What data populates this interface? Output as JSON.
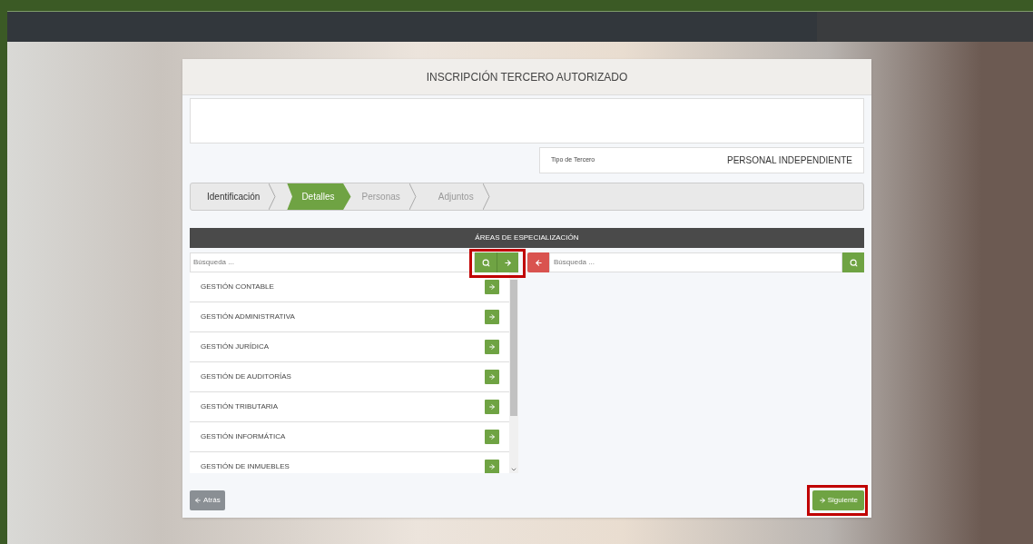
{
  "form": {
    "title": "INSCRIPCIÓN TERCERO AUTORIZADO",
    "type_label": "Tipo de Tercero",
    "type_value": "PERSONAL INDEPENDIENTE"
  },
  "steps": [
    {
      "label": "Identificación",
      "selected": false
    },
    {
      "label": "Detalles",
      "selected": true
    },
    {
      "label": "Personas",
      "selected": false
    },
    {
      "label": "Adjuntos",
      "selected": false
    }
  ],
  "areas": {
    "title": "ÁREAS DE ESPECIALIZACIÓN",
    "left_search": {
      "placeholder": "Búsqueda ..."
    },
    "right_search": {
      "placeholder": "Búsqueda ..."
    },
    "available": [
      {
        "label": "GESTIÓN CONTABLE"
      },
      {
        "label": "GESTIÓN ADMINISTRATIVA"
      },
      {
        "label": "GESTIÓN JURÍDICA"
      },
      {
        "label": "GESTIÓN DE AUDITORÍAS"
      },
      {
        "label": "GESTIÓN TRIBUTARIA"
      },
      {
        "label": "GESTIÓN INFORMÁTICA"
      },
      {
        "label": "GESTIÓN DE INMUEBLES"
      }
    ]
  },
  "buttons": {
    "back": "Atrás",
    "next": "Siguiente"
  }
}
